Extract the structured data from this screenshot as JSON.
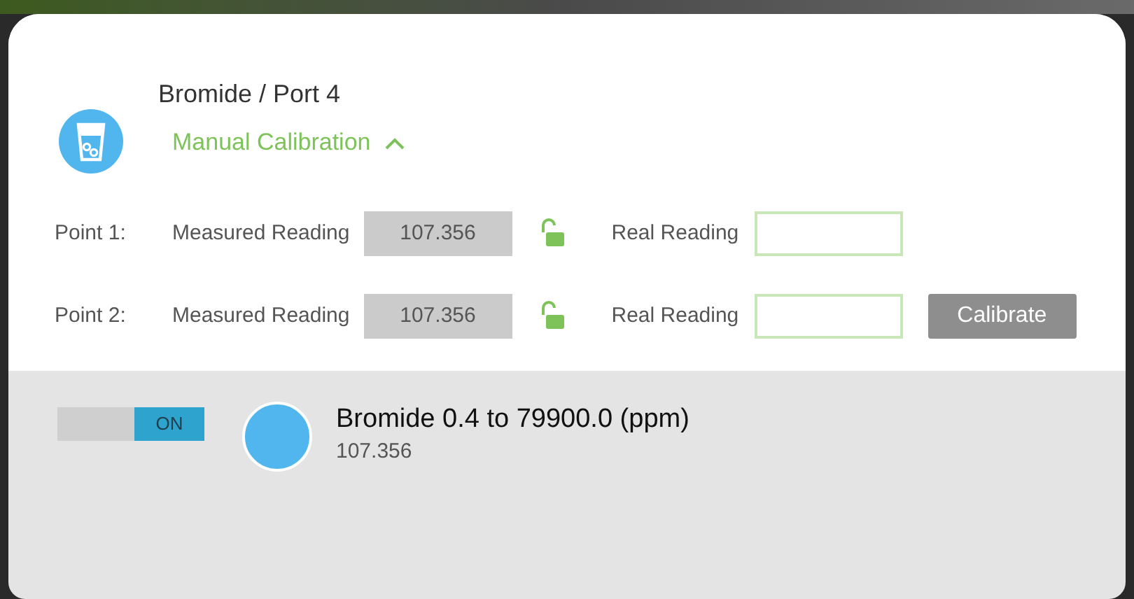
{
  "header": {
    "title": "Bromide / Port 4",
    "section": {
      "label": "Manual Calibration",
      "expanded": true
    }
  },
  "points": [
    {
      "label": "Point 1:",
      "measured_label": "Measured Reading",
      "measured_value": "107.356",
      "locked": false,
      "real_label": "Real Reading"
    },
    {
      "label": "Point 2:",
      "measured_label": "Measured Reading",
      "measured_value": "107.356",
      "locked": false,
      "real_label": "Real Reading"
    }
  ],
  "calibrate_button": "Calibrate",
  "sensor": {
    "switch": {
      "label": "ON",
      "on": true
    },
    "color": "#52b6ee",
    "name": "Bromide 0.4 to 79900.0 (ppm)",
    "reading": "107.356"
  }
}
